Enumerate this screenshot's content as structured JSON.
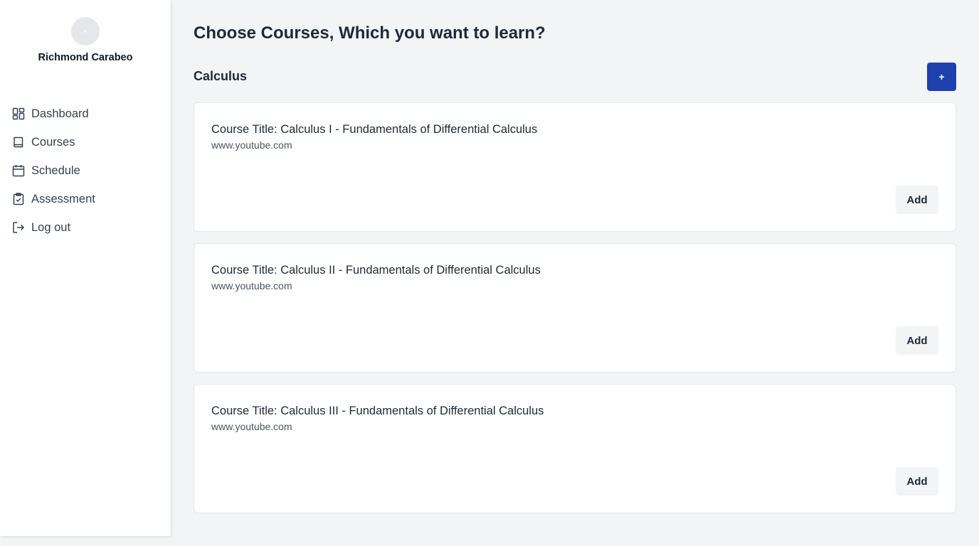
{
  "user": {
    "name": "Richmond Carabeo"
  },
  "sidebar": {
    "items": [
      {
        "label": "Dashboard",
        "icon": "dashboard-icon"
      },
      {
        "label": "Courses",
        "icon": "book-icon"
      },
      {
        "label": "Schedule",
        "icon": "calendar-icon"
      },
      {
        "label": "Assessment",
        "icon": "clipboard-check-icon"
      },
      {
        "label": "Log out",
        "icon": "logout-icon"
      }
    ]
  },
  "main": {
    "title": "Choose Courses, Which you want to learn?",
    "section_title": "Calculus",
    "add_section_label": "+",
    "courses": [
      {
        "title": "Course Title: Calculus I - Fundamentals of Differential Calculus",
        "url": "www.youtube.com",
        "add_label": "Add"
      },
      {
        "title": "Course Title: Calculus II - Fundamentals of Differential Calculus",
        "url": "www.youtube.com",
        "add_label": "Add"
      },
      {
        "title": "Course Title: Calculus III - Fundamentals of Differential Calculus",
        "url": "www.youtube.com",
        "add_label": "Add"
      }
    ]
  },
  "colors": {
    "accent": "#1e40af",
    "background": "#f3f4f6",
    "card": "#ffffff",
    "text": "#1f2937"
  }
}
